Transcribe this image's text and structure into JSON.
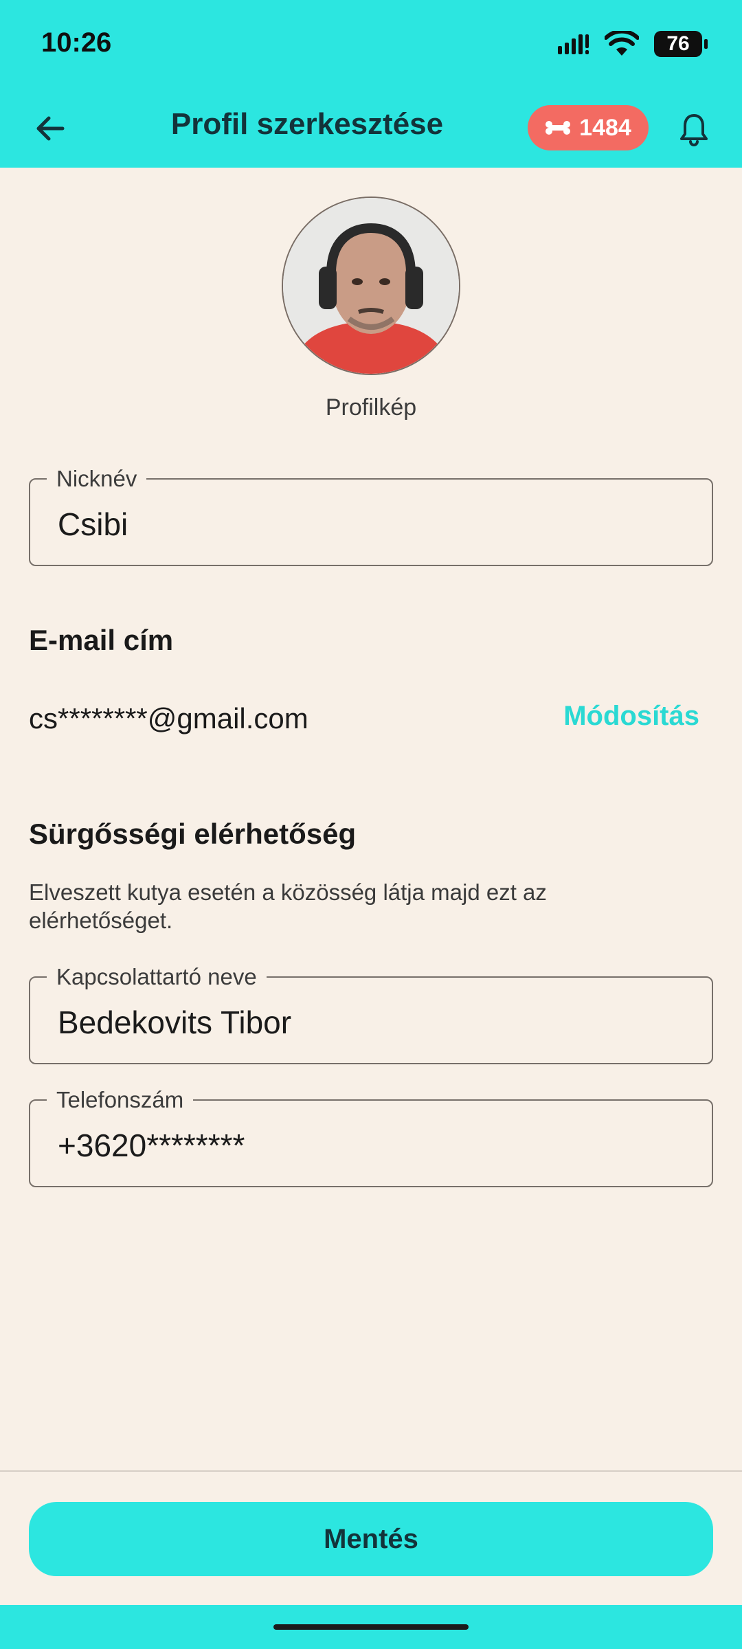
{
  "status_bar": {
    "time": "10:26",
    "battery": "76"
  },
  "app_bar": {
    "title": "Profil szerkesztése",
    "points": "1484"
  },
  "profile": {
    "avatar_caption": "Profilkép"
  },
  "nickname": {
    "label": "Nicknév",
    "value": "Csibi"
  },
  "email": {
    "title": "E-mail cím",
    "value": "cs********@gmail.com",
    "modify_label": "Módosítás"
  },
  "emergency": {
    "title": "Sürgősségi elérhetőség",
    "description": "Elveszett kutya esetén a közösség látja majd ezt az elérhetőséget.",
    "contact_name": {
      "label": "Kapcsolattartó neve",
      "value": "Bedekovits Tibor"
    },
    "phone": {
      "label": "Telefonszám",
      "value": "+3620********"
    }
  },
  "footer": {
    "save_label": "Mentés"
  },
  "colors": {
    "accent": "#2ce6e0",
    "badge": "#f36b62",
    "background": "#f8f0e7",
    "link": "#2ad9d3"
  },
  "icons": {
    "back": "arrow-left-icon",
    "points": "bone-icon",
    "notifications": "bell-icon"
  }
}
